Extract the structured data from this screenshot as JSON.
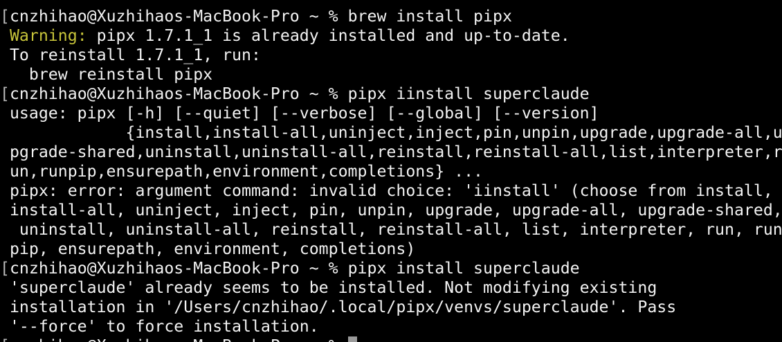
{
  "terminal": {
    "prompt_marker": "[",
    "prompt": "cnzhihao@Xuzhihaos-MacBook-Pro ~ % ",
    "cmd1": "brew install pipx",
    "warning_label": "Warning:",
    "warning_text": " pipx 1.7.1_1 is already installed and up-to-date.",
    "reinstall_intro": " To reinstall 1.7.1_1, run:",
    "reinstall_cmd": "   brew reinstall pipx",
    "cmd2": "pipx iinstall superclaude",
    "usage_line1": " usage: pipx [-h] [--quiet] [--verbose] [--global] [--version]",
    "usage_line2": "             {install,install-all,uninject,inject,pin,unpin,upgrade,upgrade-all,u",
    "usage_line3": " pgrade-shared,uninstall,uninstall-all,reinstall,reinstall-all,list,interpreter,r",
    "usage_line4": " un,runpip,ensurepath,environment,completions} ...",
    "error_line1": " pipx: error: argument command: invalid choice: 'iinstall' (choose from install,",
    "error_line2": " install-all, uninject, inject, pin, unpin, upgrade, upgrade-all, upgrade-shared,",
    "error_line3": "  uninstall, uninstall-all, reinstall, reinstall-all, list, interpreter, run, run",
    "error_line4": " pip, ensurepath, environment, completions)",
    "cmd3": "pipx install superclaude",
    "result_line1": " 'superclaude' already seems to be installed. Not modifying existing",
    "result_line2": " installation in '/Users/cnzhihao/.local/pipx/venvs/superclaude'. Pass",
    "result_line3": " '--force' to force installation."
  },
  "colors": {
    "background": "#000000",
    "text": "#f2f2f2",
    "warning": "#c7c43a",
    "cursor": "#9a9a9a"
  }
}
